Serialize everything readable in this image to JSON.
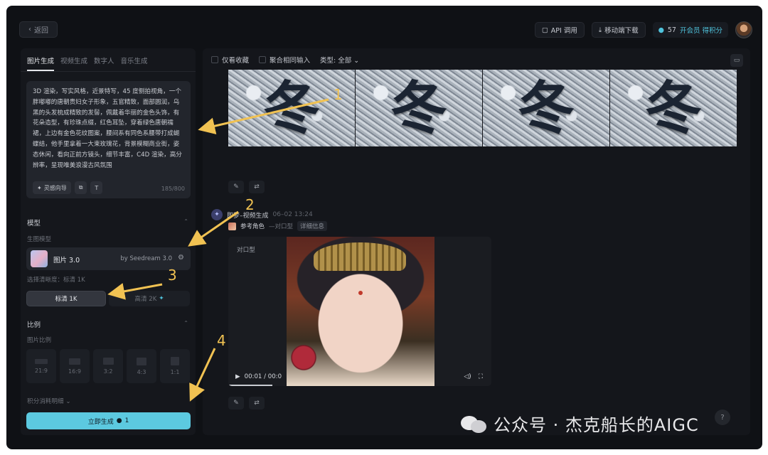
{
  "header": {
    "back_label": "返回",
    "api_label": "API 调用",
    "mobile_label": "移动端下载",
    "credits": "57",
    "member_label": "开会员 得积分"
  },
  "sidebar": {
    "tabs": [
      "图片生成",
      "视频生成",
      "数字人",
      "音乐生成"
    ],
    "prompt": "3D 渲染，写实风格，近景特写，45 度侧拍视角，一个胖嘟嘟的唐朝贵妇女子形象，五官精致，面部圆润，乌黑的头发梳成精致的发髻，佩戴着华丽的金色头饰，有花朵造型，有珍珠点缀，红色耳坠，穿着绿色唐朝襦裙，上边有金色花纹图案，腰间系有同色系腰带打成蝴蝶结，他手里拿着一大束玫瑰花，背景模糊商业街，姿态休闲，看向正前方镜头，细节丰富，C4D 渲染，高分辨率，呈现唯美浪漫古风氛围",
    "prompt_tool_1": "灵感向导",
    "counter": "185/800",
    "model_section": "模型",
    "model_sub": "生图模型",
    "model_name": "图片 3.0",
    "model_by": "by Seedream 3.0",
    "res_sub": "选择清晰度：标清 1K",
    "res_1": "标清 1K",
    "res_2": "高清 2K",
    "ratio_section": "比例",
    "ratio_sub": "图片比例",
    "ratios": [
      "21:9",
      "16:9",
      "3:2",
      "4:3",
      "1:1"
    ],
    "cost_note": "积分消耗明细",
    "generate_label": "立即生成",
    "generate_cost": "1"
  },
  "main": {
    "filter_1": "仅看收藏",
    "filter_2": "聚合相同输入",
    "filter_3": "类型: 全部",
    "result_glyph": "冬",
    "entry_name": "即梦–视频生成",
    "entry_time": "06–02 13:24",
    "ref_label": "参考角色",
    "ref_sub": "—对口型",
    "detail_label": "详细信息",
    "video_label": "对口型",
    "video_time": "00:01 / 00:0"
  },
  "annotations": [
    "1",
    "2",
    "3",
    "4"
  ],
  "watermark": "公众号 · 杰克船长的AIGC",
  "colors": {
    "accent": "#5cc9e0",
    "annotation": "#f1c252",
    "background": "#0f1115"
  }
}
